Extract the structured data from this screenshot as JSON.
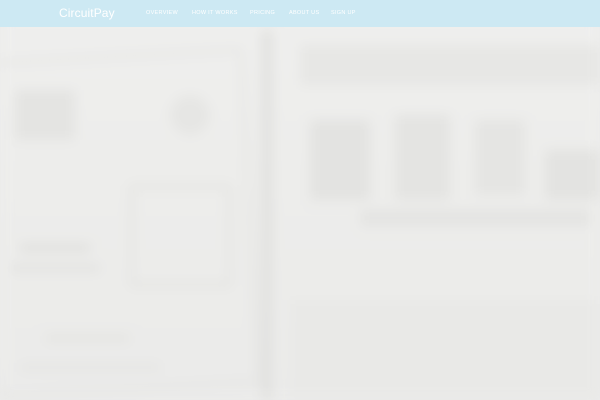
{
  "navbar": {
    "brand": "CircuitPay",
    "items": [
      {
        "label": "OVERVIEW"
      },
      {
        "label": "HOW IT WORKS"
      },
      {
        "label": "PRICING"
      },
      {
        "label": "ABOUT US"
      },
      {
        "label": "SIGN UP"
      }
    ]
  },
  "colors": {
    "navbar_bg": "#cde9f3",
    "nav_text": "#ffffff",
    "hero_bg": "#ececeb"
  }
}
